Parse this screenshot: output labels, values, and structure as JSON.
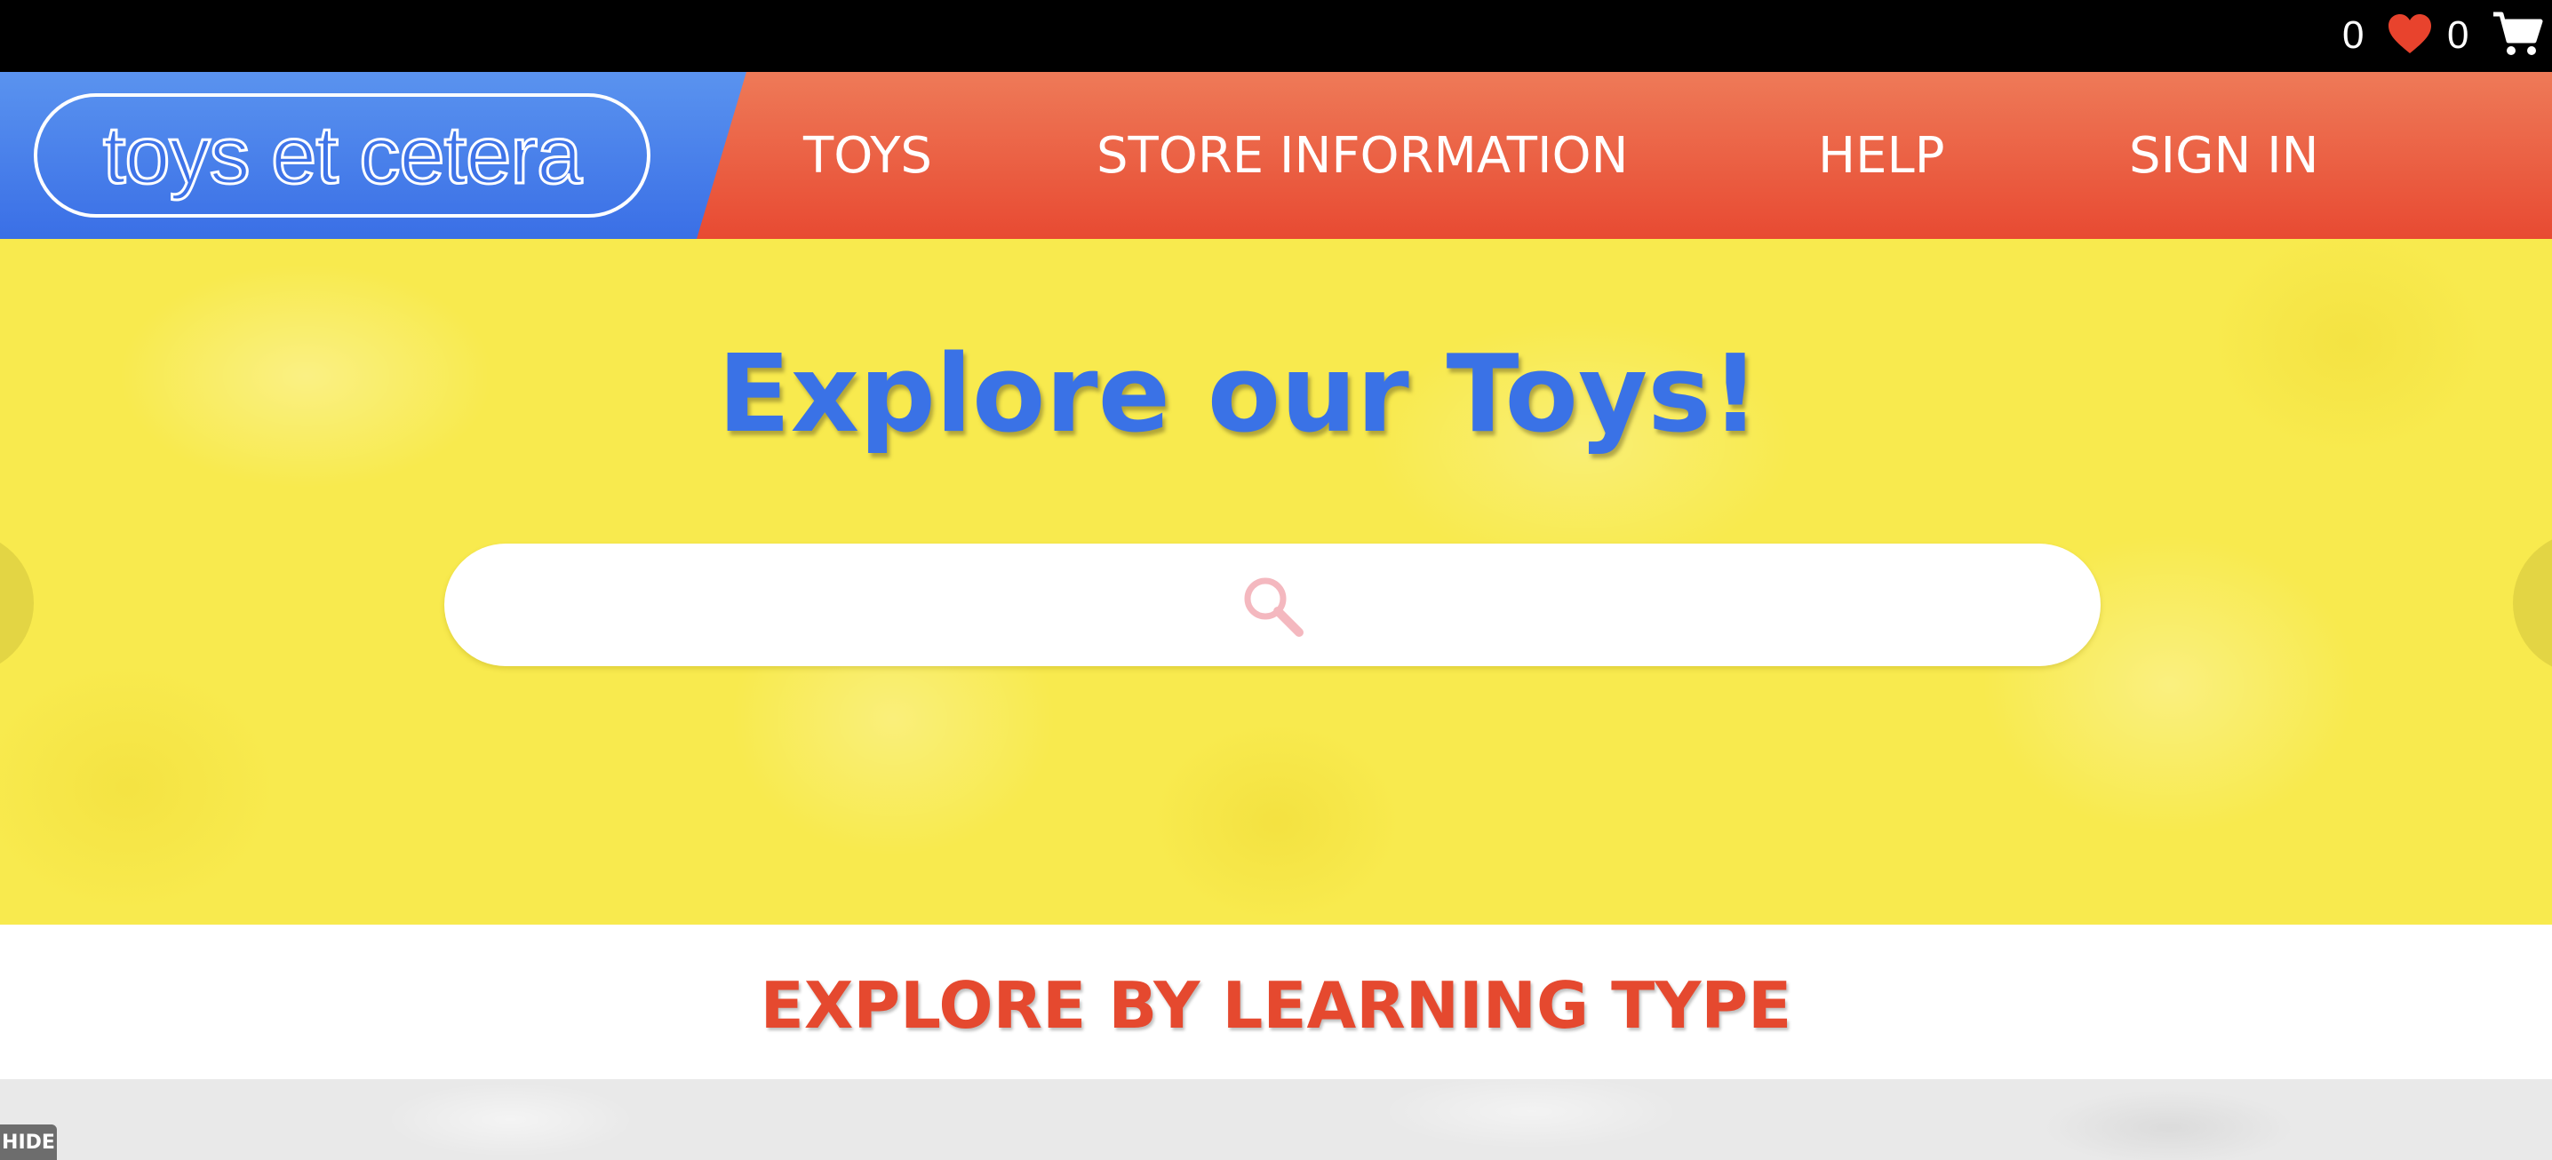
{
  "topbar": {
    "wishlist_count": "0",
    "cart_count": "0",
    "wishlist_icon": "heart-icon",
    "cart_icon": "cart-icon",
    "heart_color": "#e8432d"
  },
  "header": {
    "logo_text": "toys et cetera",
    "nav": [
      {
        "label": "TOYS"
      },
      {
        "label": "STORE INFORMATION"
      },
      {
        "label": "HELP"
      },
      {
        "label": "SIGN IN"
      }
    ],
    "colors": {
      "nav_bg": "#e84a32",
      "logo_bg": "#3a6fe6"
    }
  },
  "hero": {
    "title": "Explore our Toys!",
    "search": {
      "placeholder": "",
      "icon": "search-icon"
    },
    "colors": {
      "bg": "#f8ea4e",
      "title": "#3a72e6"
    }
  },
  "section": {
    "heading": "EXPLORE BY LEARNING TYPE",
    "color": "#e5492f"
  },
  "footer_badge": {
    "label": "HIDE"
  }
}
